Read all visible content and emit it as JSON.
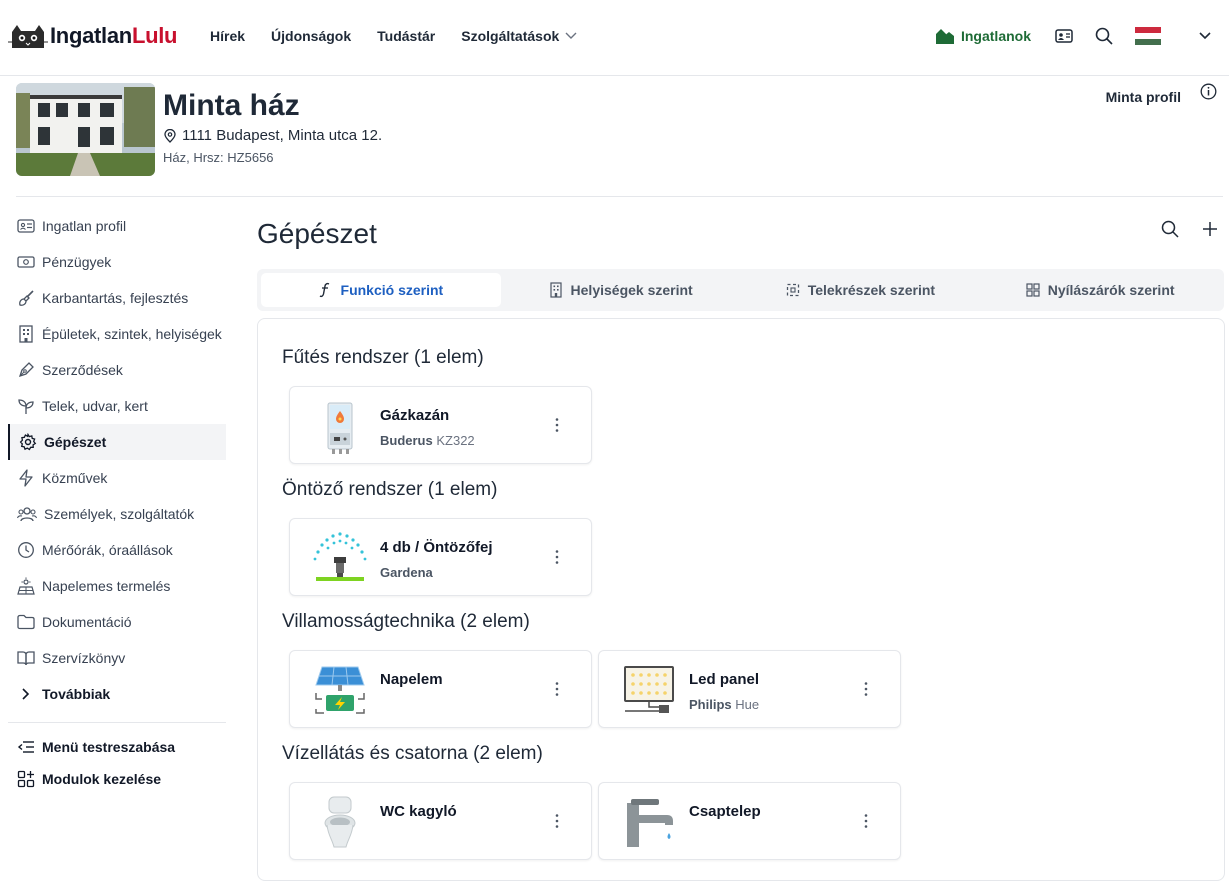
{
  "topbar": {
    "logo_part1": "Ingatlan",
    "logo_part2": "Lulu",
    "nav": [
      "Hírek",
      "Újdonságok",
      "Tudástár",
      "Szolgáltatások"
    ],
    "properties_label": "Ingatlanok"
  },
  "property": {
    "title": "Minta ház",
    "address": "1111 Budapest, Minta utca 12.",
    "sub": "Ház, Hrsz: HZ5656",
    "profile_label": "Minta profil"
  },
  "sidebar": {
    "items": [
      {
        "label": "Ingatlan profil",
        "icon": "id-card-icon"
      },
      {
        "label": "Pénzügyek",
        "icon": "banknote-icon"
      },
      {
        "label": "Karbantartás, fejlesztés",
        "icon": "brush-icon"
      },
      {
        "label": "Épületek, szintek, helyiségek",
        "icon": "building-icon"
      },
      {
        "label": "Szerződések",
        "icon": "pen-icon"
      },
      {
        "label": "Telek, udvar, kert",
        "icon": "sprout-icon"
      },
      {
        "label": "Gépészet",
        "icon": "gear-icon"
      },
      {
        "label": "Közművek",
        "icon": "bolt-icon"
      },
      {
        "label": "Személyek, szolgáltatók",
        "icon": "users-icon"
      },
      {
        "label": "Mérőórák, óraállások",
        "icon": "clock-icon"
      },
      {
        "label": "Napelemes termelés",
        "icon": "solar-icon"
      },
      {
        "label": "Dokumentáció",
        "icon": "folder-icon"
      },
      {
        "label": "Szervízkönyv",
        "icon": "book-icon"
      }
    ],
    "more_label": "Továbbiak",
    "customize_label": "Menü testreszabása",
    "modules_label": "Modulok kezelése"
  },
  "main": {
    "title": "Gépészet",
    "tabs": [
      "Funkció szerint",
      "Helyiségek szerint",
      "Telekrészek szerint",
      "Nyílászárók szerint"
    ],
    "groups": [
      {
        "title": "Fűtés rendszer (1 elem)",
        "items": [
          {
            "name": "Gázkazán",
            "brand": "Buderus",
            "model": "KZ322"
          }
        ]
      },
      {
        "title": "Öntöző rendszer (1 elem)",
        "items": [
          {
            "name": "4 db / Öntözőfej",
            "brand": "Gardena",
            "model": ""
          }
        ]
      },
      {
        "title": "Villamosságtechnika (2 elem)",
        "items": [
          {
            "name": "Napelem",
            "brand": "",
            "model": ""
          },
          {
            "name": "Led panel",
            "brand": "Philips",
            "model": "Hue"
          }
        ]
      },
      {
        "title": "Vízellátás és csatorna (2 elem)",
        "items": [
          {
            "name": "WC kagyló",
            "brand": "",
            "model": ""
          },
          {
            "name": "Csaptelep",
            "brand": "",
            "model": ""
          }
        ]
      }
    ]
  },
  "colors": {
    "accent_blue": "#1d5fc1",
    "brand_red": "#c8102e",
    "properties_green": "#1e6b36"
  }
}
